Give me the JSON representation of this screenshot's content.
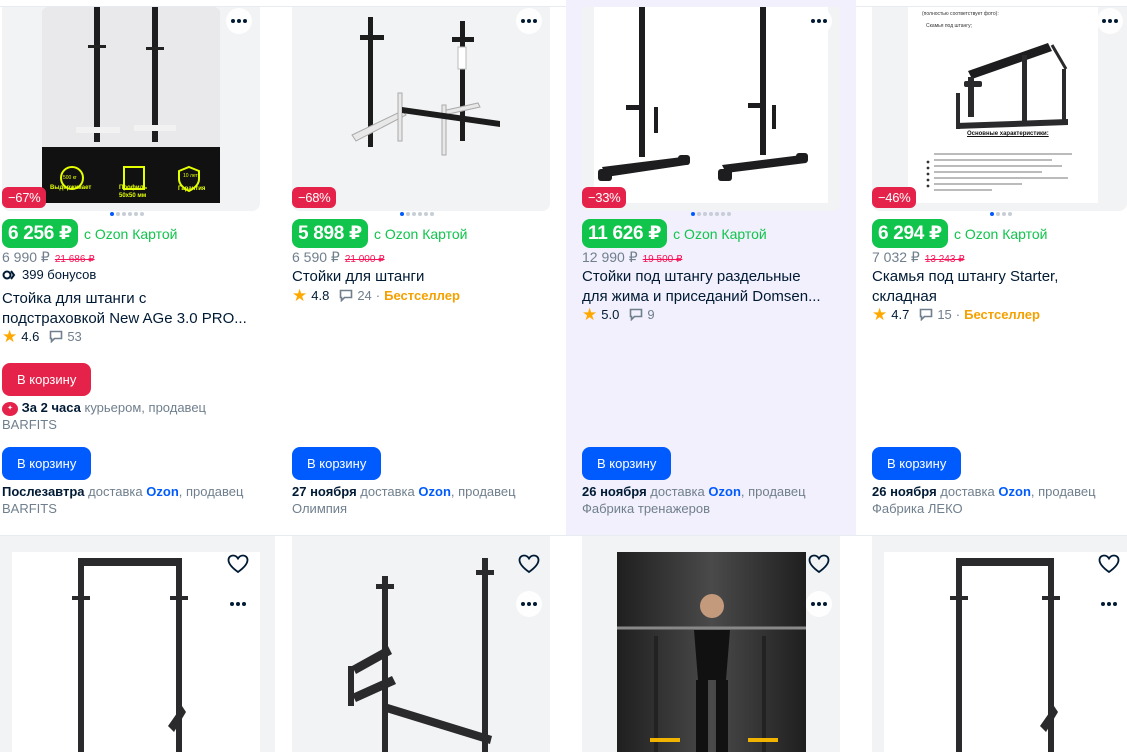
{
  "common": {
    "currency": "₽",
    "ozon_card_note": "с Ozon Картой",
    "to_cart": "В корзину",
    "delivery_word": "доставка",
    "ozon": "Ozon",
    "seller_word": ", продавец",
    "bestseller": "Бестселлер"
  },
  "products": [
    {
      "discount": "−67%",
      "price": "6 256 ₽",
      "old_price": "6 990 ₽",
      "strike_price": "21 686 ₽",
      "bonus": "399 бонусов",
      "title_line1": "Стойка для штанги с",
      "title_line2": "подстраховкой New AGe 3.0 PRO...",
      "rating": "4.6",
      "reviews": "53",
      "express_button": "В корзину",
      "express_time": "За 2 часа",
      "express_rest": "курьером, продавец",
      "express_seller": "BARFITS",
      "delivery_date": "Послезавтра",
      "seller": "BARFITS",
      "img_labels": [
        "500 кг",
        "Выдерживает",
        "Профиль",
        "50х50 мм",
        "10 лет",
        "Гарантия"
      ]
    },
    {
      "discount": "−68%",
      "price": "5 898 ₽",
      "old_price": "6 590 ₽",
      "strike_price": "21 000 ₽",
      "title_line1": "Стойки для штанги",
      "rating": "4.8",
      "reviews": "24",
      "delivery_date": "27 ноября",
      "seller": "Олимпия"
    },
    {
      "discount": "−33%",
      "price": "11 626 ₽",
      "old_price": "12 990 ₽",
      "strike_price": "19 500 ₽",
      "title_line1": "Стойки под штангу раздельные",
      "title_line2": "для жима и приседаний Domsen...",
      "rating": "5.0",
      "reviews": "9",
      "delivery_date": "26 ноября",
      "seller": "Фабрика тренажеров"
    },
    {
      "discount": "−46%",
      "price": "6 294 ₽",
      "old_price": "7 032 ₽",
      "strike_price": "13 243 ₽",
      "title_line1": "Скамья под штангу Starter,",
      "title_line2": "складная",
      "rating": "4.7",
      "reviews": "15",
      "delivery_date": "26 ноября",
      "seller": "Фабрика ЛЕКО",
      "img_heading": "Основные характеристики:",
      "img_small": "(полностью соответствует фото):",
      "img_bullet": "Скамья под штангу;"
    }
  ],
  "colors": {
    "accent": "#005bff",
    "discount": "#e5234a",
    "price": "#10c44c",
    "bestseller": "#f4a100"
  }
}
